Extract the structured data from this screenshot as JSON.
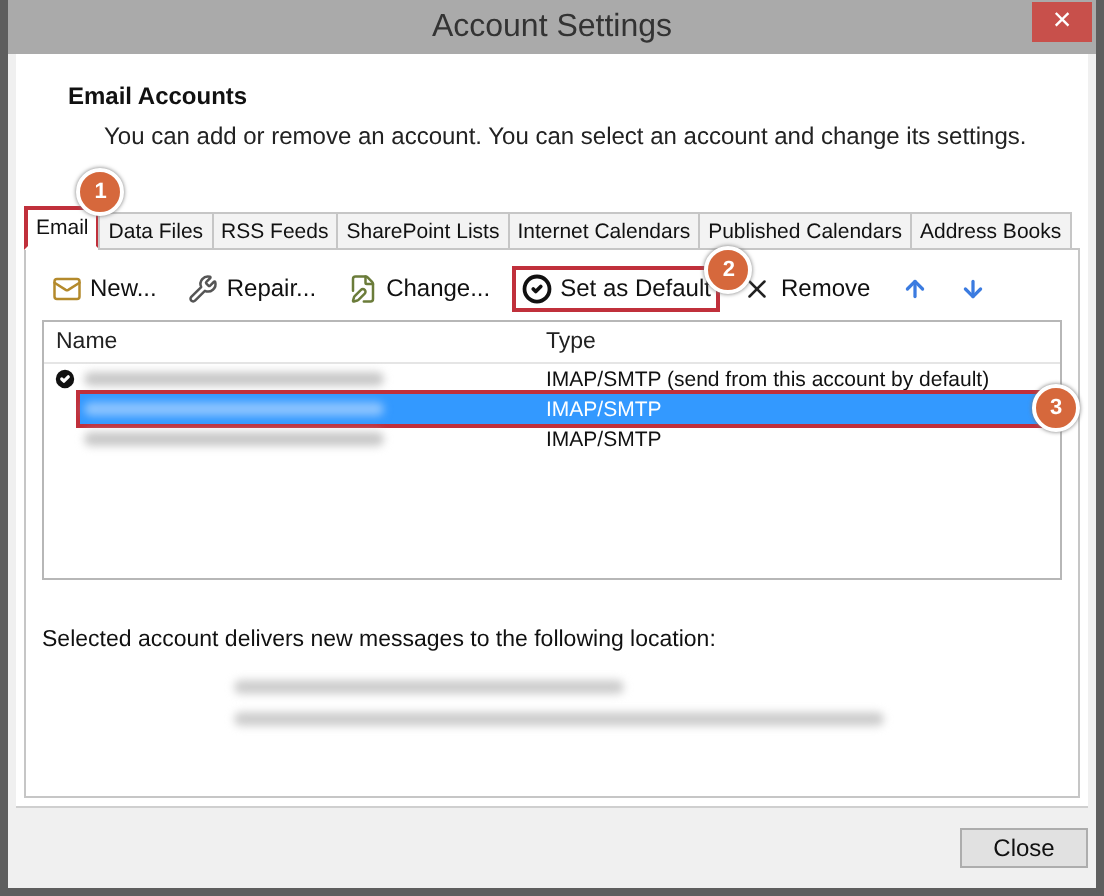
{
  "window": {
    "title": "Account Settings",
    "close": "×"
  },
  "header": {
    "title": "Email Accounts",
    "description": "You can add or remove an account. You can select an account and change its settings."
  },
  "tabs": [
    {
      "label": "Email",
      "selected": true,
      "highlighted": true,
      "callout": "1"
    },
    {
      "label": "Data Files",
      "selected": false,
      "highlighted": false
    },
    {
      "label": "RSS Feeds",
      "selected": false,
      "highlighted": false
    },
    {
      "label": "SharePoint Lists",
      "selected": false,
      "highlighted": false
    },
    {
      "label": "Internet Calendars",
      "selected": false,
      "highlighted": false
    },
    {
      "label": "Published Calendars",
      "selected": false,
      "highlighted": false
    },
    {
      "label": "Address Books",
      "selected": false,
      "highlighted": false
    }
  ],
  "toolbar": [
    {
      "kind": "new",
      "label": "New...",
      "highlighted": false
    },
    {
      "kind": "repair",
      "label": "Repair...",
      "highlighted": false
    },
    {
      "kind": "change",
      "label": "Change...",
      "highlighted": false
    },
    {
      "kind": "default",
      "label": "Set as Default",
      "highlighted": true,
      "callout": "2"
    },
    {
      "kind": "remove",
      "label": "Remove",
      "highlighted": false
    },
    {
      "kind": "up",
      "highlighted": false
    },
    {
      "kind": "down",
      "highlighted": false
    }
  ],
  "table": {
    "columns": [
      "Name",
      "Type"
    ],
    "rows": [
      {
        "type": "IMAP/SMTP (send from this account by default)",
        "default": true,
        "selected": false,
        "highlighted": false
      },
      {
        "type": "IMAP/SMTP",
        "default": false,
        "selected": true,
        "highlighted": true,
        "callout": "3"
      },
      {
        "type": "IMAP/SMTP",
        "default": false,
        "selected": false,
        "highlighted": false
      }
    ]
  },
  "delivery": {
    "label": "Selected account delivers new messages to the following location:"
  },
  "buttons": [
    {
      "label": "Close"
    }
  ]
}
